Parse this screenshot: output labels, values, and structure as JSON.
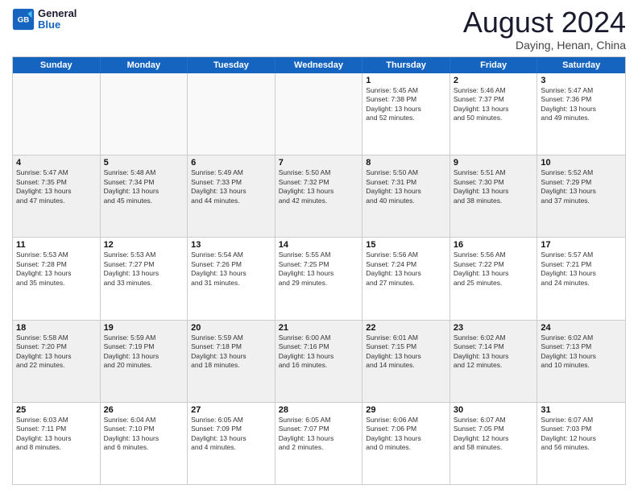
{
  "logo": {
    "line1": "General",
    "line2": "Blue"
  },
  "title": "August 2024",
  "subtitle": "Daying, Henan, China",
  "days": [
    "Sunday",
    "Monday",
    "Tuesday",
    "Wednesday",
    "Thursday",
    "Friday",
    "Saturday"
  ],
  "rows": [
    [
      {
        "day": "",
        "info": ""
      },
      {
        "day": "",
        "info": ""
      },
      {
        "day": "",
        "info": ""
      },
      {
        "day": "",
        "info": ""
      },
      {
        "day": "1",
        "info": "Sunrise: 5:45 AM\nSunset: 7:38 PM\nDaylight: 13 hours\nand 52 minutes."
      },
      {
        "day": "2",
        "info": "Sunrise: 5:46 AM\nSunset: 7:37 PM\nDaylight: 13 hours\nand 50 minutes."
      },
      {
        "day": "3",
        "info": "Sunrise: 5:47 AM\nSunset: 7:36 PM\nDaylight: 13 hours\nand 49 minutes."
      }
    ],
    [
      {
        "day": "4",
        "info": "Sunrise: 5:47 AM\nSunset: 7:35 PM\nDaylight: 13 hours\nand 47 minutes."
      },
      {
        "day": "5",
        "info": "Sunrise: 5:48 AM\nSunset: 7:34 PM\nDaylight: 13 hours\nand 45 minutes."
      },
      {
        "day": "6",
        "info": "Sunrise: 5:49 AM\nSunset: 7:33 PM\nDaylight: 13 hours\nand 44 minutes."
      },
      {
        "day": "7",
        "info": "Sunrise: 5:50 AM\nSunset: 7:32 PM\nDaylight: 13 hours\nand 42 minutes."
      },
      {
        "day": "8",
        "info": "Sunrise: 5:50 AM\nSunset: 7:31 PM\nDaylight: 13 hours\nand 40 minutes."
      },
      {
        "day": "9",
        "info": "Sunrise: 5:51 AM\nSunset: 7:30 PM\nDaylight: 13 hours\nand 38 minutes."
      },
      {
        "day": "10",
        "info": "Sunrise: 5:52 AM\nSunset: 7:29 PM\nDaylight: 13 hours\nand 37 minutes."
      }
    ],
    [
      {
        "day": "11",
        "info": "Sunrise: 5:53 AM\nSunset: 7:28 PM\nDaylight: 13 hours\nand 35 minutes."
      },
      {
        "day": "12",
        "info": "Sunrise: 5:53 AM\nSunset: 7:27 PM\nDaylight: 13 hours\nand 33 minutes."
      },
      {
        "day": "13",
        "info": "Sunrise: 5:54 AM\nSunset: 7:26 PM\nDaylight: 13 hours\nand 31 minutes."
      },
      {
        "day": "14",
        "info": "Sunrise: 5:55 AM\nSunset: 7:25 PM\nDaylight: 13 hours\nand 29 minutes."
      },
      {
        "day": "15",
        "info": "Sunrise: 5:56 AM\nSunset: 7:24 PM\nDaylight: 13 hours\nand 27 minutes."
      },
      {
        "day": "16",
        "info": "Sunrise: 5:56 AM\nSunset: 7:22 PM\nDaylight: 13 hours\nand 25 minutes."
      },
      {
        "day": "17",
        "info": "Sunrise: 5:57 AM\nSunset: 7:21 PM\nDaylight: 13 hours\nand 24 minutes."
      }
    ],
    [
      {
        "day": "18",
        "info": "Sunrise: 5:58 AM\nSunset: 7:20 PM\nDaylight: 13 hours\nand 22 minutes."
      },
      {
        "day": "19",
        "info": "Sunrise: 5:59 AM\nSunset: 7:19 PM\nDaylight: 13 hours\nand 20 minutes."
      },
      {
        "day": "20",
        "info": "Sunrise: 5:59 AM\nSunset: 7:18 PM\nDaylight: 13 hours\nand 18 minutes."
      },
      {
        "day": "21",
        "info": "Sunrise: 6:00 AM\nSunset: 7:16 PM\nDaylight: 13 hours\nand 16 minutes."
      },
      {
        "day": "22",
        "info": "Sunrise: 6:01 AM\nSunset: 7:15 PM\nDaylight: 13 hours\nand 14 minutes."
      },
      {
        "day": "23",
        "info": "Sunrise: 6:02 AM\nSunset: 7:14 PM\nDaylight: 13 hours\nand 12 minutes."
      },
      {
        "day": "24",
        "info": "Sunrise: 6:02 AM\nSunset: 7:13 PM\nDaylight: 13 hours\nand 10 minutes."
      }
    ],
    [
      {
        "day": "25",
        "info": "Sunrise: 6:03 AM\nSunset: 7:11 PM\nDaylight: 13 hours\nand 8 minutes."
      },
      {
        "day": "26",
        "info": "Sunrise: 6:04 AM\nSunset: 7:10 PM\nDaylight: 13 hours\nand 6 minutes."
      },
      {
        "day": "27",
        "info": "Sunrise: 6:05 AM\nSunset: 7:09 PM\nDaylight: 13 hours\nand 4 minutes."
      },
      {
        "day": "28",
        "info": "Sunrise: 6:05 AM\nSunset: 7:07 PM\nDaylight: 13 hours\nand 2 minutes."
      },
      {
        "day": "29",
        "info": "Sunrise: 6:06 AM\nSunset: 7:06 PM\nDaylight: 13 hours\nand 0 minutes."
      },
      {
        "day": "30",
        "info": "Sunrise: 6:07 AM\nSunset: 7:05 PM\nDaylight: 12 hours\nand 58 minutes."
      },
      {
        "day": "31",
        "info": "Sunrise: 6:07 AM\nSunset: 7:03 PM\nDaylight: 12 hours\nand 56 minutes."
      }
    ]
  ]
}
